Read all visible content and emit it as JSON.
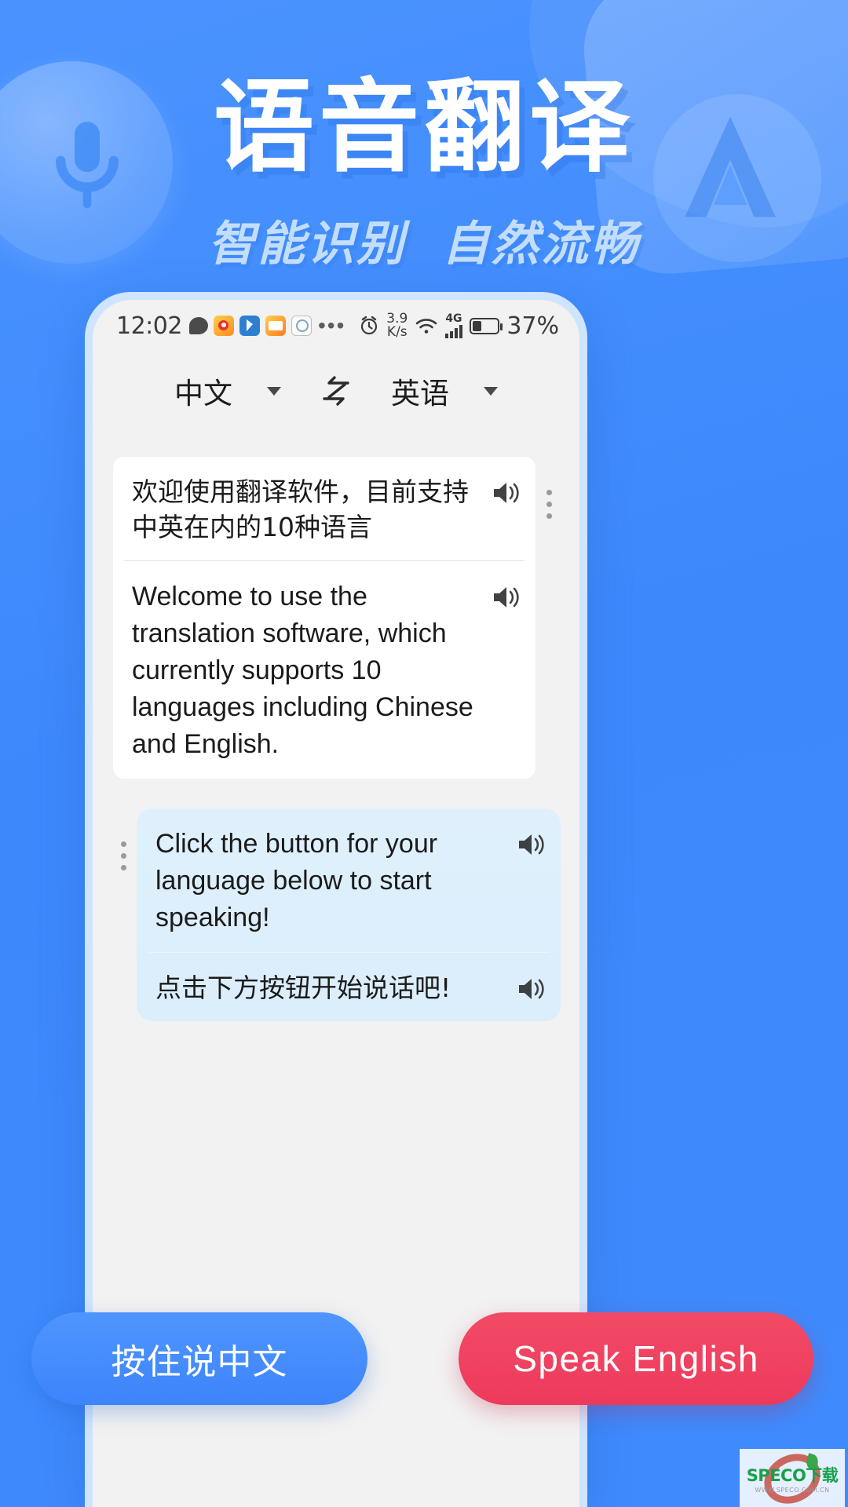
{
  "poster": {
    "title": "语音翻译",
    "subtitle_left": "智能识别",
    "subtitle_right": "自然流畅",
    "bg_color": "#3d8bff",
    "title_color": "#ffffff",
    "subtitle_color": "#c3defc"
  },
  "phone": {
    "status_bar": {
      "time": "12:02",
      "network_speed": "3.9",
      "network_speed_unit": "K/s",
      "network_type": "4G",
      "battery_percent": "37%",
      "icons": [
        "chat-icon",
        "weibo-icon",
        "video-icon",
        "mail-icon",
        "search-icon",
        "overflow-dots-icon",
        "alarm-icon",
        "wifi-icon",
        "signal-icon",
        "battery-icon"
      ]
    },
    "language_bar": {
      "source_language": "中文",
      "target_language": "英语",
      "swap_icon": "swap-arrows-icon",
      "dropdown_icon": "chevron-down-icon"
    },
    "conversation": [
      {
        "side": "left",
        "style": "white",
        "segments": [
          {
            "text": "欢迎使用翻译软件，目前支持中英在内的10种语言",
            "lang": "zh",
            "speaker_icon": "speaker-icon"
          },
          {
            "text": "Welcome to use the translation software, which currently supports 10 languages including Chinese and English.",
            "lang": "en",
            "speaker_icon": "speaker-icon"
          }
        ]
      },
      {
        "side": "right",
        "style": "blue",
        "segments": [
          {
            "text": "Click the button for your language below to start speaking!",
            "lang": "en",
            "speaker_icon": "speaker-icon"
          },
          {
            "text": "点击下方按钮开始说话吧!",
            "lang": "zh",
            "speaker_icon": "speaker-icon"
          }
        ]
      }
    ],
    "actions": {
      "speak_chinese_label": "按住说中文",
      "speak_english_label": "Speak English",
      "chinese_color": "#4a91fe",
      "english_color": "#ee3e5f"
    }
  },
  "watermark": {
    "brand": "SPECO下载",
    "url": "WWW.SPECO.COM.CN"
  }
}
